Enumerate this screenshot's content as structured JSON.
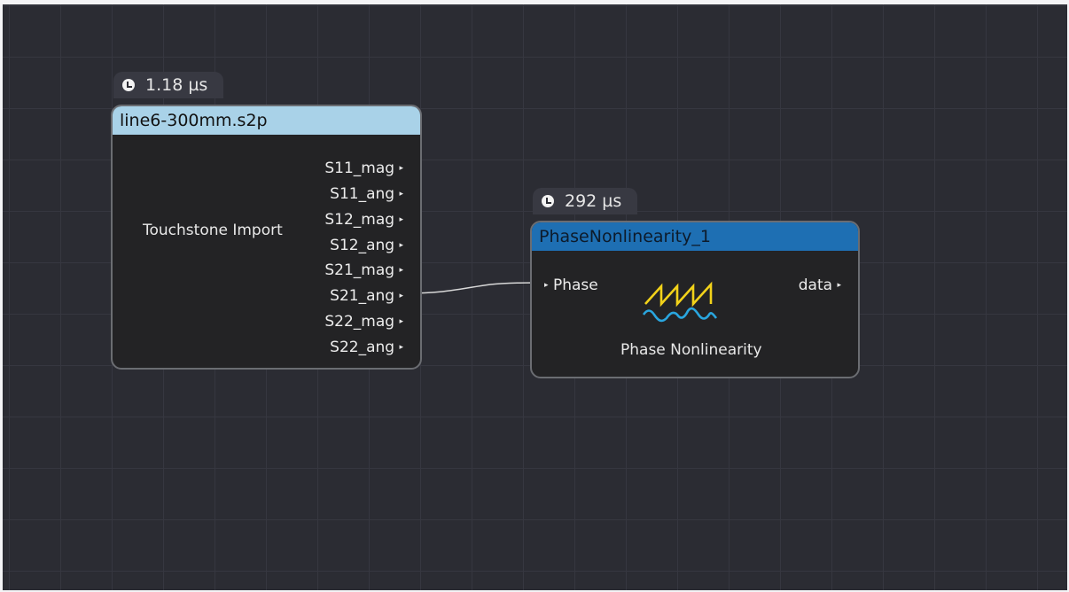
{
  "nodes": [
    {
      "id": "touchstone",
      "timer": "1.18 µs",
      "title": "line6-300mm.s2p",
      "label": "Touchstone Import",
      "outputs": [
        "S11_mag",
        "S11_ang",
        "S12_mag",
        "S12_ang",
        "S21_mag",
        "S21_ang",
        "S22_mag",
        "S22_ang"
      ]
    },
    {
      "id": "phase",
      "timer": "292 µs",
      "title": "PhaseNonlinearity_1",
      "label": "Phase Nonlinearity",
      "inputs": [
        "Phase"
      ],
      "outputs": [
        "data"
      ],
      "icon": "phase-nonlinearity-icon"
    }
  ],
  "connections": [
    {
      "from": "touchstone.S21_ang",
      "to": "phase.Phase"
    }
  ],
  "colors": {
    "canvas": "#2b2c33",
    "grid": "#363740",
    "touchstone_header": "#a9d2e8",
    "phase_header": "#1e6fb3",
    "icon_sawtooth": "#f2d21a",
    "icon_wave": "#2aa6df"
  }
}
